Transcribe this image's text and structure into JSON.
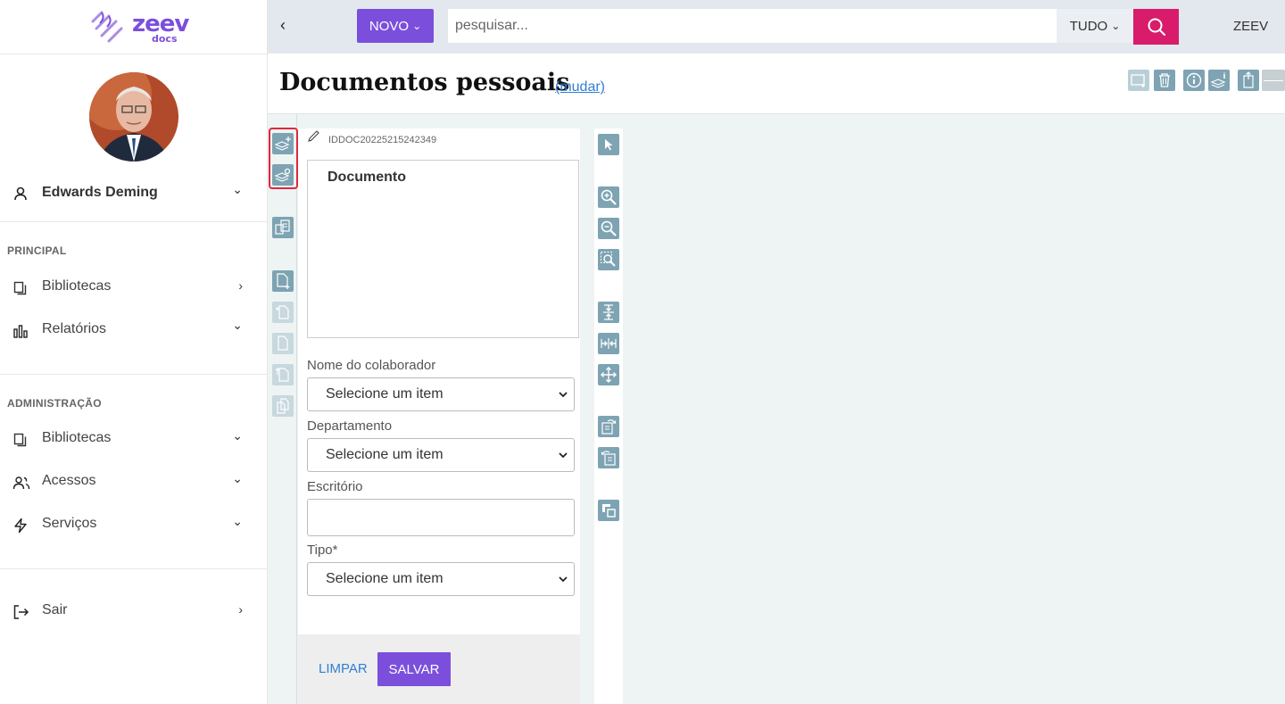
{
  "sidebar": {
    "logo": {
      "word": "zeev",
      "sub": "docs"
    },
    "user": {
      "name": "Edwards Deming"
    },
    "sections": [
      {
        "title": "PRINCIPAL",
        "items": [
          {
            "label": "Bibliotecas",
            "icon": "library-icon",
            "chevron": "›"
          },
          {
            "label": "Relatórios",
            "icon": "bar-chart-icon",
            "chevron": "⌄"
          }
        ]
      },
      {
        "title": "ADMINISTRAÇÃO",
        "items": [
          {
            "label": "Bibliotecas",
            "icon": "library-icon",
            "chevron": "⌄"
          },
          {
            "label": "Acessos",
            "icon": "users-icon",
            "chevron": "⌄"
          },
          {
            "label": "Serviços",
            "icon": "bolt-icon",
            "chevron": "⌄"
          }
        ]
      }
    ],
    "logout": {
      "label": "Sair"
    }
  },
  "topbar": {
    "back": "‹",
    "novo_label": "NOVO",
    "search_placeholder": "pesquisar...",
    "scope": "TUDO",
    "org": "ZEEV"
  },
  "header": {
    "title": "Documentos pessoais",
    "change_link": "(mudar)"
  },
  "form": {
    "doc_id": "IDDOC20225215242349",
    "doc_box_title": "Documento",
    "fields": [
      {
        "label": "Nome do colaborador",
        "type": "select",
        "value": "Selecione um item"
      },
      {
        "label": "Departamento",
        "type": "select",
        "value": "Selecione um item"
      },
      {
        "label": "Escritório",
        "type": "text",
        "value": ""
      },
      {
        "label": "Tipo*",
        "type": "select",
        "value": "Selecione um item"
      }
    ],
    "clear_label": "LIMPAR",
    "save_label": "SALVAR"
  },
  "colors": {
    "accent": "#7b4fdc",
    "search": "#d81b6b",
    "tool": "#7ea3b3",
    "highlight": "#e0283c"
  }
}
